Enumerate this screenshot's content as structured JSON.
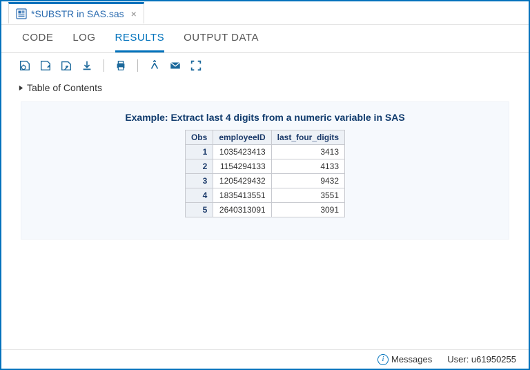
{
  "file_tab": {
    "label": "*SUBSTR in SAS.sas"
  },
  "subtabs": {
    "code": "CODE",
    "log": "LOG",
    "results": "RESULTS",
    "output_data": "OUTPUT DATA"
  },
  "toc_label": "Table of Contents",
  "result": {
    "title": "Example: Extract last 4 digits from a numeric variable in SAS",
    "headers": {
      "obs": "Obs",
      "emp": "employeeID",
      "last4": "last_four_digits"
    },
    "rows": [
      {
        "obs": "1",
        "emp": "1035423413",
        "last4": "3413"
      },
      {
        "obs": "2",
        "emp": "1154294133",
        "last4": "4133"
      },
      {
        "obs": "3",
        "emp": "1205429432",
        "last4": "9432"
      },
      {
        "obs": "4",
        "emp": "1835413551",
        "last4": "3551"
      },
      {
        "obs": "5",
        "emp": "2640313091",
        "last4": "3091"
      }
    ]
  },
  "footer": {
    "messages": "Messages",
    "user_label": "User: ",
    "user_id": "u61950255"
  },
  "chart_data": {
    "type": "table",
    "title": "Example: Extract last 4 digits from a numeric variable in SAS",
    "columns": [
      "Obs",
      "employeeID",
      "last_four_digits"
    ],
    "rows": [
      [
        1,
        1035423413,
        3413
      ],
      [
        2,
        1154294133,
        4133
      ],
      [
        3,
        1205429432,
        9432
      ],
      [
        4,
        1835413551,
        3551
      ],
      [
        5,
        2640313091,
        3091
      ]
    ]
  }
}
